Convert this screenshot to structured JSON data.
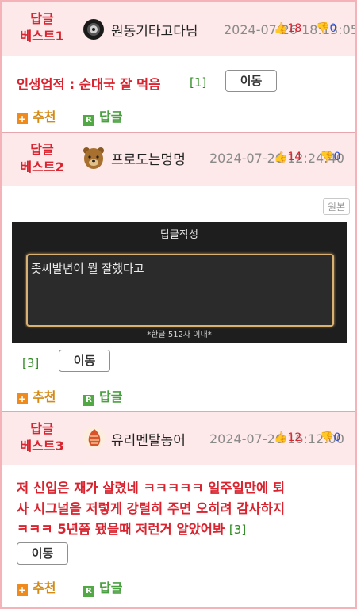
{
  "posts": [
    {
      "badge_line1": "답글",
      "badge_line2": "베스트1",
      "nickname": "원동기타고다님",
      "date": "2024-07-26 18:13:05",
      "up": "18",
      "down": "0",
      "content": "인생업적 : 순대국 잘 먹음",
      "comment_count": "[1]",
      "move_label": "이동",
      "recommend_label": "추천",
      "reply_label": "답글"
    },
    {
      "badge_line1": "답글",
      "badge_line2": "베스트2",
      "nickname": "프로도는멍멍",
      "date": "2024-07-26 12:24:40",
      "up": "14",
      "down": "0",
      "original_label": "원본",
      "image_title": "답글작성",
      "image_text": "좆씨발년이 뭘 잘했다고",
      "image_caption": "*한글 512자 이내*",
      "comment_count": "[3]",
      "move_label": "이동",
      "recommend_label": "추천",
      "reply_label": "답글"
    },
    {
      "badge_line1": "답글",
      "badge_line2": "베스트3",
      "nickname": "유리멘탈농어",
      "date": "2024-07-26 16:12:00",
      "up": "12",
      "down": "0",
      "content_line1": "저 신입은 재가 살렸네 ㅋㅋㅋㅋㅋ 일주일만에 퇴",
      "content_line2": "사 시그널을 저렇게 강렬히 주면 오히려 감사하지",
      "content_line3": "ㅋㅋㅋ 5년쯤 됐을때 저런거 알았어봐",
      "comment_count": "[3]",
      "move_label": "이동",
      "recommend_label": "추천",
      "reply_label": "답글"
    }
  ],
  "icons": {
    "plus": "+",
    "reply_icon": "R",
    "thumb_up": "👍",
    "thumb_down": "👎"
  },
  "colors": {
    "badge_red": "#d9232e",
    "header_bg": "#fde8ea",
    "frame_border": "#f4b3b8",
    "recommend_orange": "#d48a13",
    "reply_green": "#4aa040"
  }
}
